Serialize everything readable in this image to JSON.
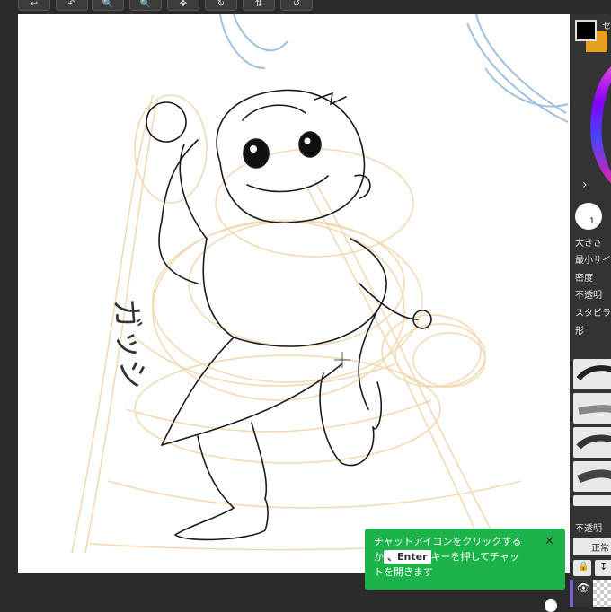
{
  "toolbar": {
    "buttons": [
      "back-icon",
      "undo-icon",
      "zoom-out-icon",
      "zoom-in-icon",
      "move-icon",
      "rotate-icon",
      "flip-icon",
      "reset-icon"
    ]
  },
  "canvas": {
    "sketch_text": "ガッシ"
  },
  "right_panel": {
    "header_fragment": "セ",
    "expand_arrow": "›",
    "brush_size_badge": "1",
    "labels": {
      "size": "大きさ",
      "min_size": "最小サイ",
      "density": "密度",
      "opacity": "不透明",
      "stabilizer": "スタビラ",
      "shape": "形"
    },
    "layer_opacity": "不透明",
    "blend_mode": "正常",
    "colors": {
      "fg": "#000000",
      "bg": "#e8a020",
      "panel": "#333333"
    }
  },
  "tooltip": {
    "line1": "チャットアイコンをクリックする",
    "line2_prefix": "か",
    "key": "、Enter",
    "line2_suffix": "キーを押してチャッ",
    "line3": "トを開きます",
    "close": "✕",
    "color": "#1db34b"
  }
}
